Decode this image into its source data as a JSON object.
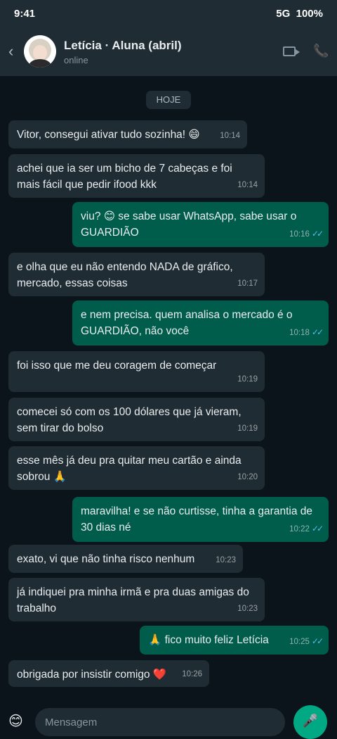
{
  "status": {
    "time": "9:41",
    "network": "5G",
    "battery": "100%"
  },
  "header": {
    "back": "‹",
    "name": "Letícia · Aluna (abril)",
    "status": "online",
    "call_glyph": "📞"
  },
  "day_label": "HOJE",
  "messages": [
    {
      "dir": "in",
      "text": "Vitor, consegui ativar tudo sozinha! 😄",
      "time": "10:14"
    },
    {
      "dir": "in",
      "text": "achei que ia ser um bicho de 7 cabeças e foi mais fácil que pedir ifood kkk",
      "time": "10:14"
    },
    {
      "dir": "out",
      "text": "viu? 😊 se sabe usar WhatsApp, sabe usar o GUARDIÃO",
      "time": "10:16",
      "ticks": "✓✓"
    },
    {
      "dir": "in",
      "text": "e olha que eu não entendo NADA de gráfico, mercado, essas coisas",
      "time": "10:17"
    },
    {
      "dir": "out",
      "text": "e nem precisa. quem analisa o mercado é o GUARDIÃO, não você",
      "time": "10:18",
      "ticks": "✓✓"
    },
    {
      "dir": "in",
      "text": "foi isso que me deu coragem de começar",
      "time": "10:19"
    },
    {
      "dir": "in",
      "text": "comecei só com os 100 dólares que já vieram, sem tirar do bolso",
      "time": "10:19"
    },
    {
      "dir": "in",
      "text": "esse mês já deu pra quitar meu cartão e ainda sobrou 🙏",
      "time": "10:20"
    },
    {
      "dir": "out",
      "text": "maravilha! e se não curtisse, tinha a garantia de 30 dias né",
      "time": "10:22",
      "ticks": "✓✓"
    },
    {
      "dir": "in",
      "text": "exato, vi que não tinha risco nenhum",
      "time": "10:23"
    },
    {
      "dir": "in",
      "text": "já indiquei pra minha irmã e pra duas amigas do trabalho",
      "time": "10:23"
    },
    {
      "dir": "out",
      "text": "🙏 fico muito feliz Letícia",
      "time": "10:25",
      "ticks": "✓✓"
    },
    {
      "dir": "in",
      "text": "obrigada por insistir comigo ❤️",
      "time": "10:26"
    }
  ],
  "composer": {
    "emoji": "😊",
    "placeholder": "Mensagem",
    "mic": "🎤"
  }
}
